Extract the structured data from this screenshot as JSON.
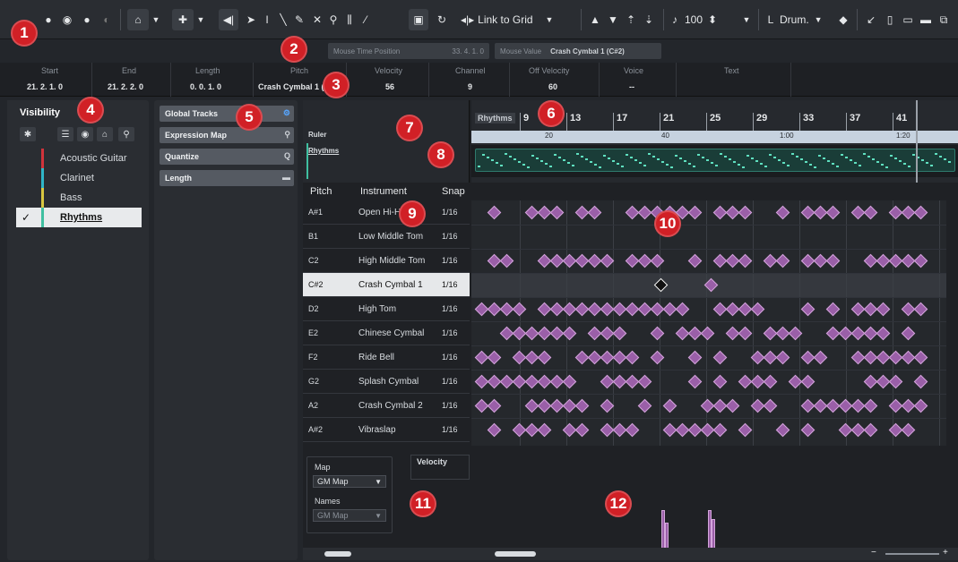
{
  "toolbar": {
    "snap_mode": "Link to Grid",
    "quantize_value": "100",
    "drum_length": "L",
    "drum_label": "Drum."
  },
  "mouse_info": {
    "time_label": "Mouse Time Position",
    "time_value": "33.  4.  1.    0",
    "value_label": "Mouse Value",
    "value_value": "Crash Cymbal 1 (C#2)"
  },
  "info_line": {
    "start_label": "Start",
    "start_value": "21.  2.  1.    0",
    "end_label": "End",
    "end_value": "21.  2.  2.    0",
    "length_label": "Length",
    "length_value": "0.  0.  1.    0",
    "pitch_label": "Pitch",
    "pitch_value": "Crash Cymbal 1 (",
    "velocity_label": "Velocity",
    "velocity_value": "56",
    "channel_label": "Channel",
    "channel_value": "9",
    "off_velocity_label": "Off Velocity",
    "off_velocity_value": "60",
    "voice_label": "Voice",
    "voice_value": "--",
    "text_label": "Text"
  },
  "visibility": {
    "title": "Visibility",
    "tracks": [
      {
        "label": "Acoustic Guitar",
        "color": "#d1333b",
        "checked": false
      },
      {
        "label": "Clarinet",
        "color": "#2fb6c8",
        "checked": false
      },
      {
        "label": "Bass",
        "color": "#d8c640",
        "checked": false
      },
      {
        "label": "Rhythms",
        "color": "#3fbfa0",
        "checked": true
      }
    ]
  },
  "inspector": {
    "sections": [
      {
        "label": "Global Tracks",
        "icon": "settings-icon"
      },
      {
        "label": "Expression Map",
        "icon": "link-icon"
      },
      {
        "label": "Quantize",
        "icon": "quantize-icon"
      },
      {
        "label": "Length",
        "icon": "length-icon"
      }
    ]
  },
  "editor": {
    "ruler_track": "Ruler",
    "rhythms_track": "Rhythms",
    "ruler_label": "Rhythms",
    "bars": [
      "9",
      "13",
      "17",
      "21",
      "25",
      "29",
      "33",
      "37",
      "41"
    ],
    "time_marks": [
      "20",
      "40",
      "1:00",
      "1:20"
    ],
    "col_pitch": "Pitch",
    "col_instrument": "Instrument",
    "col_snap": "Snap",
    "rows": [
      {
        "pitch": "A#1",
        "instrument": "Open Hi-Hat",
        "snap": "1/16"
      },
      {
        "pitch": "B1",
        "instrument": "Low Middle Tom",
        "snap": "1/16"
      },
      {
        "pitch": "C2",
        "instrument": "High Middle Tom",
        "snap": "1/16"
      },
      {
        "pitch": "C#2",
        "instrument": "Crash Cymbal 1",
        "snap": "1/16"
      },
      {
        "pitch": "D2",
        "instrument": "High Tom",
        "snap": "1/16"
      },
      {
        "pitch": "E2",
        "instrument": "Chinese Cymbal",
        "snap": "1/16"
      },
      {
        "pitch": "F2",
        "instrument": "Ride Bell",
        "snap": "1/16"
      },
      {
        "pitch": "G2",
        "instrument": "Splash Cymbal",
        "snap": "1/16"
      },
      {
        "pitch": "A2",
        "instrument": "Crash Cymbal 2",
        "snap": "1/16"
      },
      {
        "pitch": "A#2",
        "instrument": "Vibraslap",
        "snap": "1/16"
      }
    ],
    "map_label": "Map",
    "map_value": "GM Map",
    "names_label": "Names",
    "names_value": "GM Map",
    "velocity_label": "Velocity"
  },
  "callouts": [
    "1",
    "2",
    "3",
    "4",
    "5",
    "6",
    "7",
    "8",
    "9",
    "10",
    "11",
    "12"
  ],
  "colors": {
    "accent_red": "#d12026",
    "note_purple": "#9a5fa8",
    "track_green": "#3fbfa0"
  }
}
